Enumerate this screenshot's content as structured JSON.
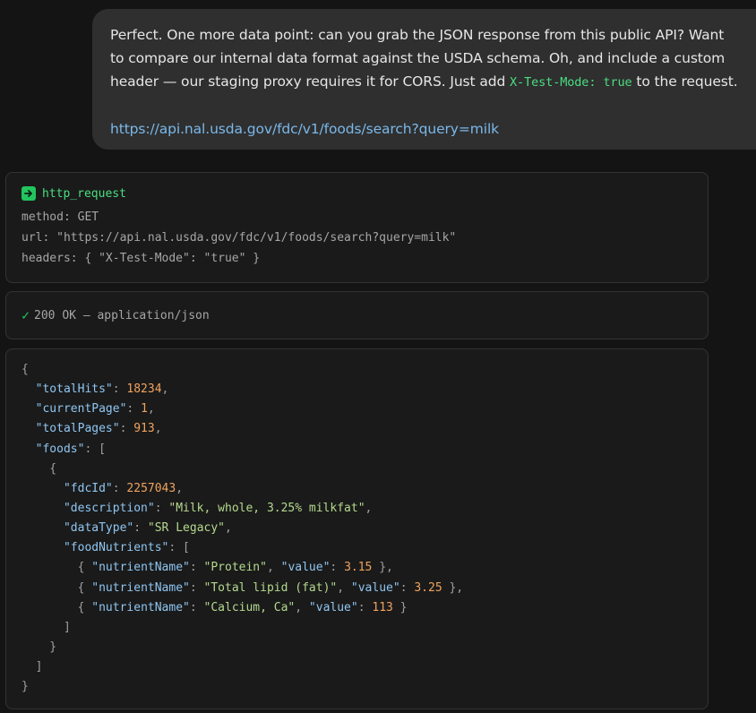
{
  "user_message": {
    "text_before_code": "Perfect. One more data point: can you grab the JSON response from this public API? Want to compare our internal data format against the USDA schema. Oh, and include a custom header — our staging proxy requires it for CORS. Just add ",
    "inline_code": "X-Test-Mode: true",
    "text_after_code": " to the request.",
    "link": "https://api.nal.usda.gov/fdc/v1/foods/search?query=milk"
  },
  "tool_call": {
    "name": "http_request",
    "icon": "arrow-right-icon",
    "lines": [
      "method: GET",
      "url: \"https://api.nal.usda.gov/fdc/v1/foods/search?query=milk\"",
      "headers: { \"X-Test-Mode\": \"true\" }"
    ]
  },
  "status": {
    "check": "✓",
    "text": "200 OK — application/json"
  },
  "response_json": {
    "lines": [
      [
        {
          "t": "p",
          "v": "{"
        }
      ],
      [
        {
          "t": "p",
          "v": "  "
        },
        {
          "t": "k",
          "v": "\"totalHits\""
        },
        {
          "t": "p",
          "v": ": "
        },
        {
          "t": "n",
          "v": "18234"
        },
        {
          "t": "p",
          "v": ","
        }
      ],
      [
        {
          "t": "p",
          "v": "  "
        },
        {
          "t": "k",
          "v": "\"currentPage\""
        },
        {
          "t": "p",
          "v": ": "
        },
        {
          "t": "n",
          "v": "1"
        },
        {
          "t": "p",
          "v": ","
        }
      ],
      [
        {
          "t": "p",
          "v": "  "
        },
        {
          "t": "k",
          "v": "\"totalPages\""
        },
        {
          "t": "p",
          "v": ": "
        },
        {
          "t": "n",
          "v": "913"
        },
        {
          "t": "p",
          "v": ","
        }
      ],
      [
        {
          "t": "p",
          "v": "  "
        },
        {
          "t": "k",
          "v": "\"foods\""
        },
        {
          "t": "p",
          "v": ": ["
        }
      ],
      [
        {
          "t": "p",
          "v": "    {"
        }
      ],
      [
        {
          "t": "p",
          "v": "      "
        },
        {
          "t": "k",
          "v": "\"fdcId\""
        },
        {
          "t": "p",
          "v": ": "
        },
        {
          "t": "n",
          "v": "2257043"
        },
        {
          "t": "p",
          "v": ","
        }
      ],
      [
        {
          "t": "p",
          "v": "      "
        },
        {
          "t": "k",
          "v": "\"description\""
        },
        {
          "t": "p",
          "v": ": "
        },
        {
          "t": "s",
          "v": "\"Milk, whole, 3.25% milkfat\""
        },
        {
          "t": "p",
          "v": ","
        }
      ],
      [
        {
          "t": "p",
          "v": "      "
        },
        {
          "t": "k",
          "v": "\"dataType\""
        },
        {
          "t": "p",
          "v": ": "
        },
        {
          "t": "s",
          "v": "\"SR Legacy\""
        },
        {
          "t": "p",
          "v": ","
        }
      ],
      [
        {
          "t": "p",
          "v": "      "
        },
        {
          "t": "k",
          "v": "\"foodNutrients\""
        },
        {
          "t": "p",
          "v": ": ["
        }
      ],
      [
        {
          "t": "p",
          "v": "        { "
        },
        {
          "t": "k",
          "v": "\"nutrientName\""
        },
        {
          "t": "p",
          "v": ": "
        },
        {
          "t": "s",
          "v": "\"Protein\""
        },
        {
          "t": "p",
          "v": ", "
        },
        {
          "t": "k",
          "v": "\"value\""
        },
        {
          "t": "p",
          "v": ": "
        },
        {
          "t": "n",
          "v": "3.15"
        },
        {
          "t": "p",
          "v": " },"
        }
      ],
      [
        {
          "t": "p",
          "v": "        { "
        },
        {
          "t": "k",
          "v": "\"nutrientName\""
        },
        {
          "t": "p",
          "v": ": "
        },
        {
          "t": "s",
          "v": "\"Total lipid (fat)\""
        },
        {
          "t": "p",
          "v": ", "
        },
        {
          "t": "k",
          "v": "\"value\""
        },
        {
          "t": "p",
          "v": ": "
        },
        {
          "t": "n",
          "v": "3.25"
        },
        {
          "t": "p",
          "v": " },"
        }
      ],
      [
        {
          "t": "p",
          "v": "        { "
        },
        {
          "t": "k",
          "v": "\"nutrientName\""
        },
        {
          "t": "p",
          "v": ": "
        },
        {
          "t": "s",
          "v": "\"Calcium, Ca\""
        },
        {
          "t": "p",
          "v": ", "
        },
        {
          "t": "k",
          "v": "\"value\""
        },
        {
          "t": "p",
          "v": ": "
        },
        {
          "t": "n",
          "v": "113"
        },
        {
          "t": "p",
          "v": " }"
        }
      ],
      [
        {
          "t": "p",
          "v": "      ]"
        }
      ],
      [
        {
          "t": "p",
          "v": "    }"
        }
      ],
      [
        {
          "t": "p",
          "v": "  ]"
        }
      ],
      [
        {
          "t": "p",
          "v": "}"
        }
      ]
    ]
  },
  "colors": {
    "background": "#141414",
    "bubble": "#2f2f2f",
    "accent_green": "#4ade80",
    "link": "#7ab8ea",
    "json_key": "#8fc6f2",
    "json_string": "#b5d98e",
    "json_number": "#f0a35e"
  }
}
